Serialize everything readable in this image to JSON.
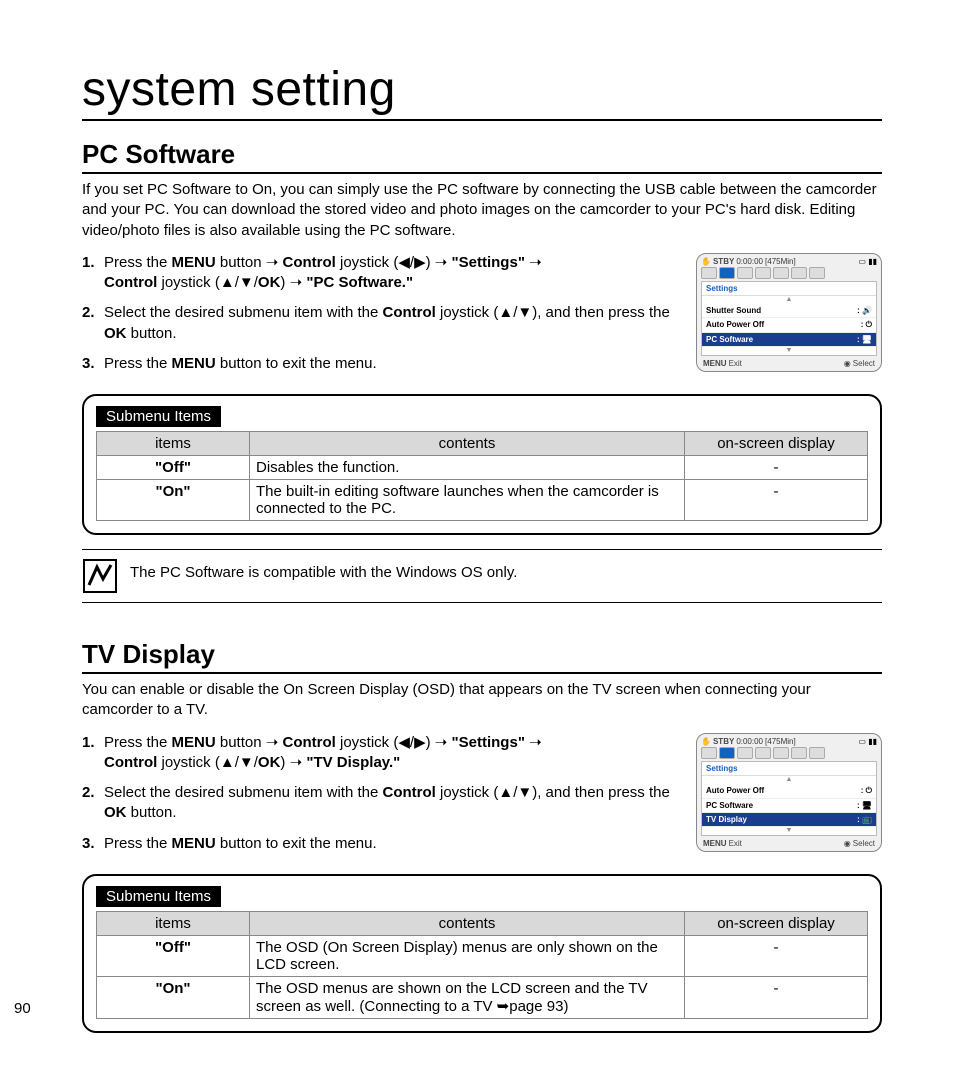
{
  "page": {
    "number": "90",
    "title": "system setting"
  },
  "section1": {
    "title": "PC Software",
    "intro": "If you set PC Software to On, you can simply use the PC software by connecting the USB cable between the camcorder and your PC. You can download the stored video and photo images on the camcorder to your PC's hard disk. Editing video/photo files is also available using the PC software.",
    "steps": {
      "s1a": "Press the ",
      "s1_menu": "MENU",
      "s1b": " button ",
      "arrow": "➝",
      "s1_control": "Control",
      "s1c": " joystick (",
      "tri_l": "◀",
      "slash": "/",
      "tri_r": "▶",
      "s1d": ") ",
      "s1_settings": "\"Settings\"",
      "s1e": " ",
      "s1f": " joystick (",
      "tri_u": "▲",
      "tri_d": "▼",
      "ok": "OK",
      "s1g": ") ",
      "s1_target": "\"PC Software.\"",
      "s2a": "Select the desired submenu item with the ",
      "s2b": " joystick (",
      "s2c": "), and then press the ",
      "s2d": " button.",
      "s3a": "Press the ",
      "s3b": " button to exit the menu."
    },
    "table": {
      "label": "Submenu Items",
      "h1": "items",
      "h2": "contents",
      "h3": "on-screen display",
      "r1": {
        "item": "\"Off\"",
        "content": "Disables the function.",
        "osd": "-"
      },
      "r2": {
        "item": "\"On\"",
        "content": "The built-in editing software launches when the camcorder is connected to the PC.",
        "osd": "-"
      }
    },
    "note": "The PC Software is compatible with the Windows OS only.",
    "osd": {
      "stby": "STBY",
      "time": "0:00:00",
      "remain": "[475Min]",
      "settings": "Settings",
      "row1": "Shutter Sound",
      "row2": "Auto Power Off",
      "row3": "PC Software",
      "menu": "MENU",
      "exit": "Exit",
      "select": "Select"
    }
  },
  "section2": {
    "title": "TV Display",
    "intro": "You can enable or disable the On Screen Display (OSD) that appears on the TV screen when connecting your camcorder to a TV.",
    "steps": {
      "s1_target": "\"TV Display.\""
    },
    "table": {
      "label": "Submenu Items",
      "h1": "items",
      "h2": "contents",
      "h3": "on-screen display",
      "r1": {
        "item": "\"Off\"",
        "content": "The OSD (On Screen Display) menus are only shown on the LCD screen.",
        "osd": "-"
      },
      "r2": {
        "item": "\"On\"",
        "content": "The OSD menus are shown on the LCD screen and the TV screen as well. (Connecting to a TV ➥page 93)",
        "osd": "-"
      }
    },
    "osd": {
      "row1": "Auto Power Off",
      "row2": "PC Software",
      "row3": "TV Display"
    }
  }
}
